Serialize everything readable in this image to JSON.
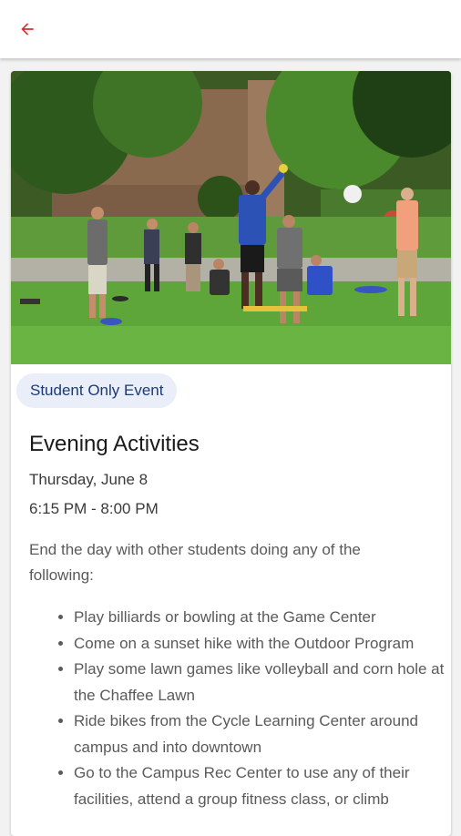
{
  "header": {
    "back_icon": "arrow-left-icon",
    "accent_color": "#d32f2f"
  },
  "event": {
    "image_alt": "Students playing lawn games on a campus lawn in the evening",
    "badge": "Student Only Event",
    "title": "Evening Activities",
    "date": "Thursday, June 8",
    "time": "6:15 PM - 8:00 PM",
    "intro": "End the day with other students doing any of the following:",
    "activities": [
      "Play billiards or bowling at the Game Center",
      "Come on a sunset hike with the Outdoor Program",
      "Play some lawn games like volleyball and corn hole at the Chaffee Lawn",
      "Ride bikes from the Cycle Learning Center around campus and into downtown",
      "Go to the Campus Rec Center to use any of their facilities, attend a group fitness class, or climb"
    ]
  }
}
